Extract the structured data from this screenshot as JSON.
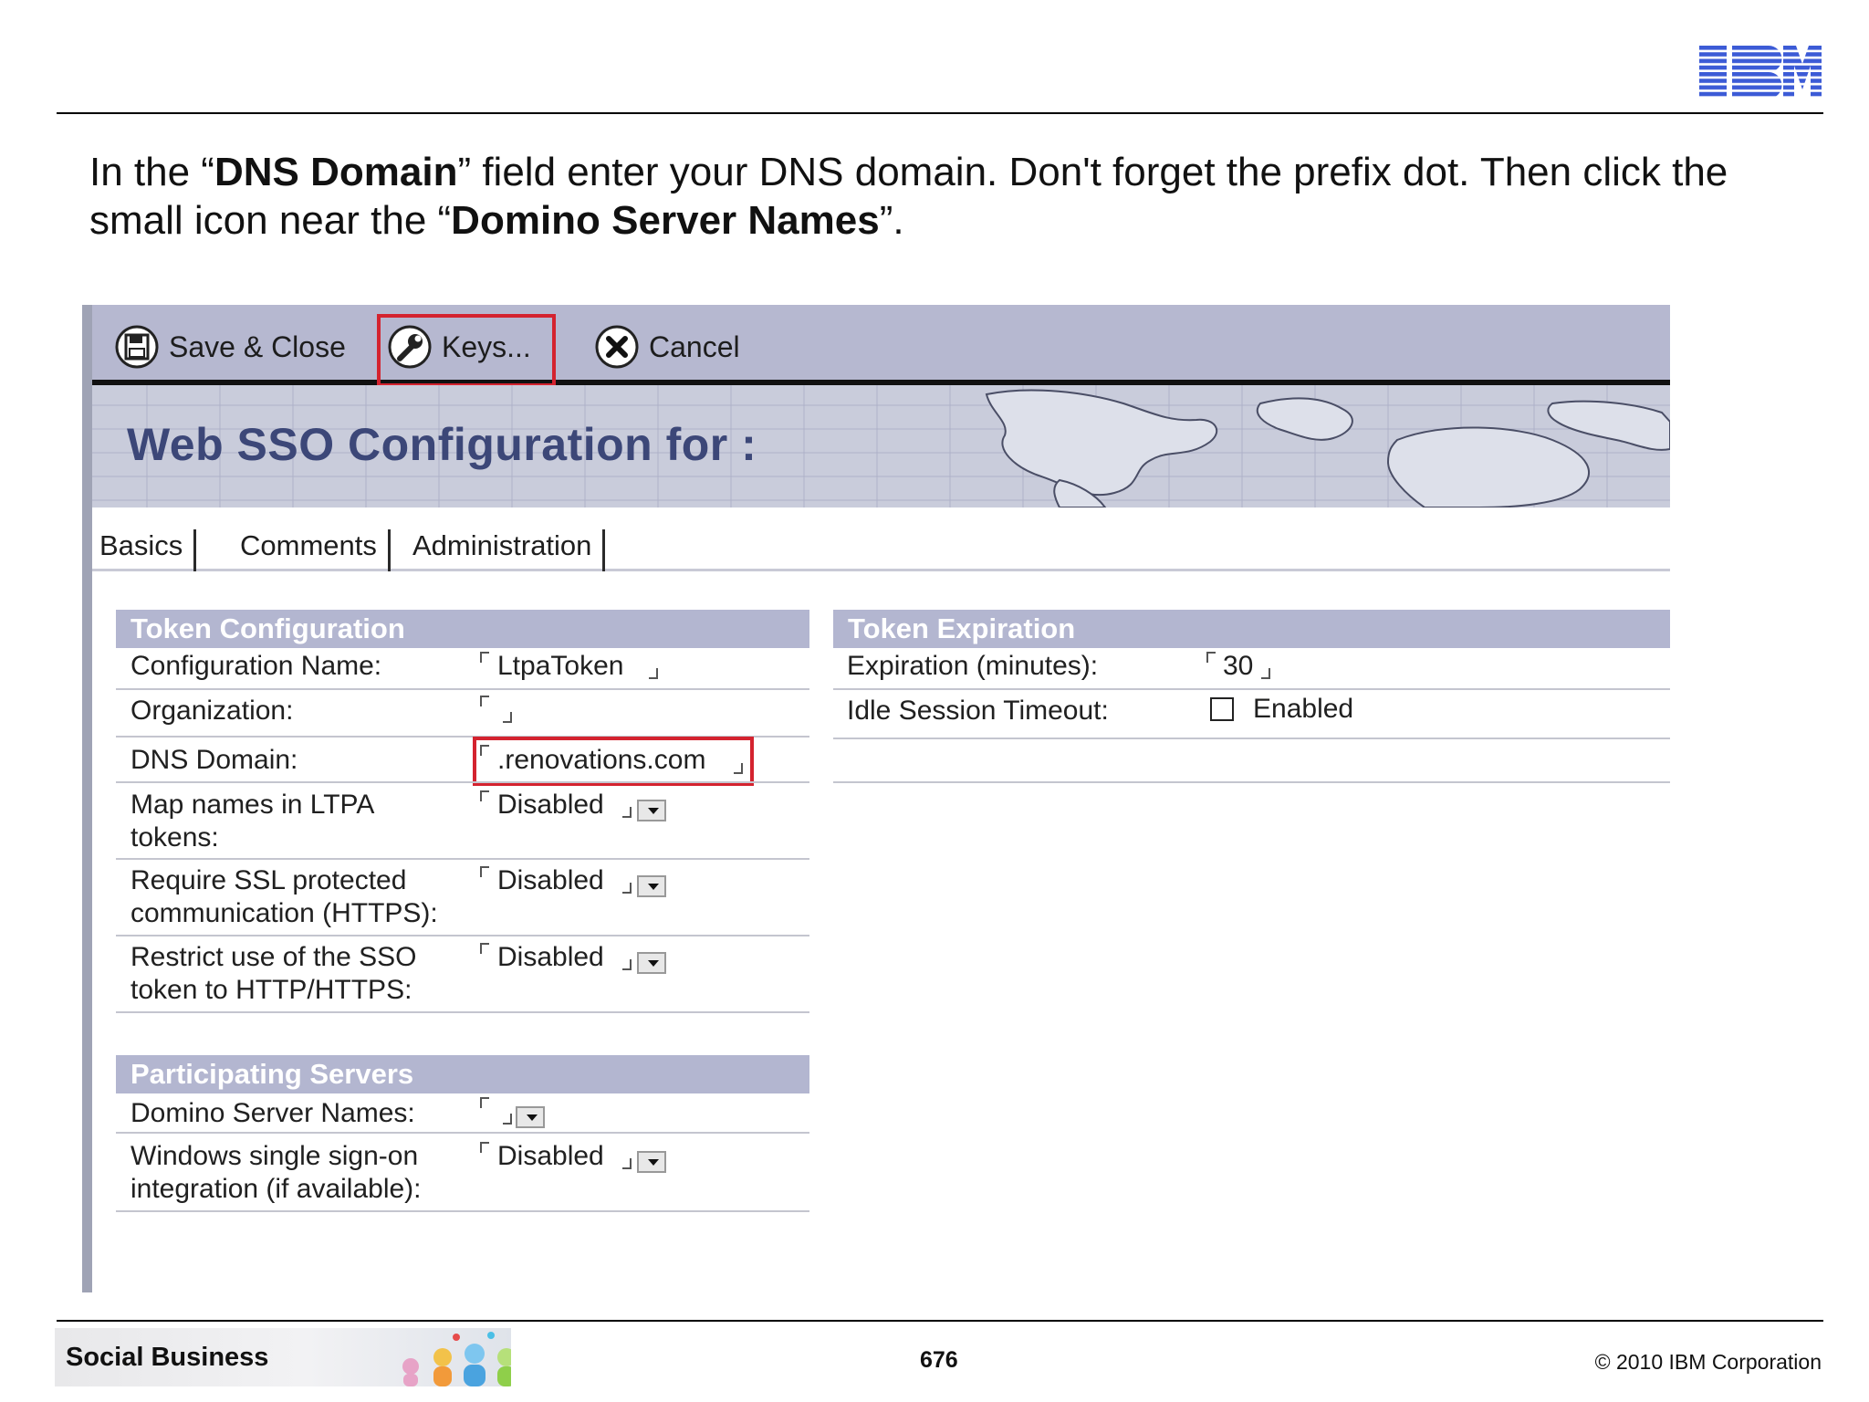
{
  "slide": {
    "instruction": {
      "p1": "In the “",
      "b1": "DNS Domain",
      "p2": "” field enter your DNS domain. Don't forget the prefix dot. Then click the small icon near the “",
      "b2": "Domino Server Names",
      "p3": "”."
    },
    "footer": {
      "brand": "Social Business",
      "page_number": "676",
      "copyright": "© 2010 IBM Corporation"
    },
    "logo_text": "IBM"
  },
  "toolbar": {
    "save_close": "Save & Close",
    "keys": "Keys...",
    "cancel": "Cancel"
  },
  "banner": {
    "title": "Web SSO Configuration for :"
  },
  "tabs": [
    "Basics",
    "Comments",
    "Administration"
  ],
  "token_configuration": {
    "header": "Token Configuration",
    "rows": [
      {
        "label": "Configuration Name:",
        "value": "LtpaToken"
      },
      {
        "label": "Organization:",
        "value": ""
      },
      {
        "label": "DNS Domain:",
        "value": ".renovations.com"
      },
      {
        "label_line1": "Map names in LTPA",
        "label_line2": "tokens:",
        "value": "Disabled"
      },
      {
        "label_line1": "Require SSL protected",
        "label_line2": "communication (HTTPS):",
        "value": "Disabled"
      },
      {
        "label_line1": "Restrict use of the SSO",
        "label_line2": "token to HTTP/HTTPS:",
        "value": "Disabled"
      }
    ]
  },
  "token_expiration": {
    "header": "Token Expiration",
    "rows": [
      {
        "label": "Expiration (minutes):",
        "value": "30"
      },
      {
        "label": "Idle Session Timeout:",
        "value": "Enabled",
        "checked": false
      }
    ]
  },
  "participating_servers": {
    "header": "Participating Servers",
    "rows": [
      {
        "label": "Domino Server Names:",
        "value": ""
      },
      {
        "label_line1": "Windows single sign-on",
        "label_line2": "integration (if available):",
        "value": "Disabled"
      }
    ]
  },
  "colors": {
    "highlight": "#d4232f",
    "toolbar_bg": "#b6b8d0",
    "section_header_bg": "#b3b6d0",
    "banner_title": "#3c4778"
  }
}
